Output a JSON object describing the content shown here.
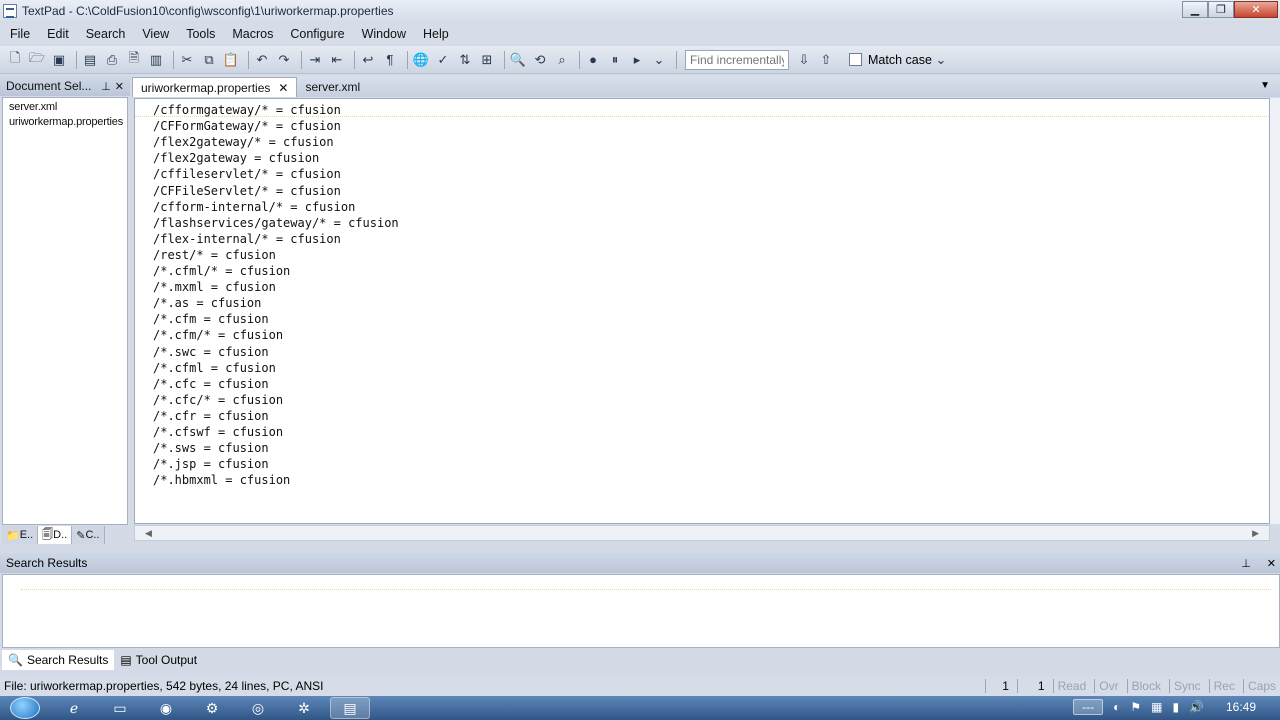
{
  "window": {
    "title": "TextPad - C:\\ColdFusion10\\config\\wsconfig\\1\\uriworkermap.properties",
    "minimize": "▁",
    "maximize": "❐",
    "close": "✕"
  },
  "menu": [
    "File",
    "Edit",
    "Search",
    "View",
    "Tools",
    "Macros",
    "Configure",
    "Window",
    "Help"
  ],
  "toolbar": {
    "find_placeholder": "Find incrementally",
    "match_case_label": "Match case"
  },
  "document_selector": {
    "title": "Document Sel...",
    "pin": "⊥",
    "close": "✕",
    "files": [
      "server.xml",
      "uriworkermap.properties"
    ],
    "tabs": [
      "E..",
      "D..",
      "C.."
    ]
  },
  "editor_tabs": [
    {
      "label": "uriworkermap.properties",
      "close": "✕"
    },
    {
      "label": "server.xml"
    }
  ],
  "editor": {
    "lines": [
      "/cfformgateway/* = cfusion",
      "/CFFormGateway/* = cfusion",
      "/flex2gateway/* = cfusion",
      "/flex2gateway = cfusion",
      "/cffileservlet/* = cfusion",
      "/CFFileServlet/* = cfusion",
      "/cfform-internal/* = cfusion",
      "/flashservices/gateway/* = cfusion",
      "/flex-internal/* = cfusion",
      "/rest/* = cfusion",
      "/*.cfml/* = cfusion",
      "/*.mxml = cfusion",
      "/*.as = cfusion",
      "/*.cfm = cfusion",
      "/*.cfm/* = cfusion",
      "/*.swc = cfusion",
      "/*.cfml = cfusion",
      "/*.cfc = cfusion",
      "/*.cfc/* = cfusion",
      "/*.cfr = cfusion",
      "/*.cfswf = cfusion",
      "/*.sws = cfusion",
      "/*.jsp = cfusion",
      "/*.hbmxml = cfusion"
    ]
  },
  "search_results": {
    "title": "Search Results",
    "pin": "⊥",
    "close": "✕",
    "tabs": [
      "Search Results",
      "Tool Output"
    ]
  },
  "status": {
    "text": "File: uriworkermap.properties, 542 bytes, 24 lines, PC, ANSI",
    "line": "1",
    "col": "1",
    "modes": [
      "Read",
      "Ovr",
      "Block",
      "Sync",
      "Rec",
      "Caps"
    ]
  },
  "taskbar": {
    "tray_placeholder": "---",
    "clock": "16:49"
  }
}
